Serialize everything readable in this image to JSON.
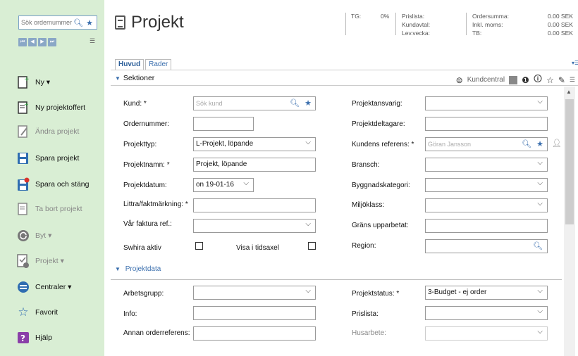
{
  "sidebar": {
    "search_placeholder": "Sök ordernummer",
    "nav": [
      "⏮",
      "◀",
      "▶",
      "⏭"
    ],
    "items": [
      {
        "label": "Ny ▾",
        "icon": "new-document-icon"
      },
      {
        "label": "Ny projektoffert",
        "icon": "quote-document-icon"
      },
      {
        "label": "Ändra projekt",
        "icon": "edit-document-icon"
      },
      {
        "label": "Spara projekt",
        "icon": "save-icon"
      },
      {
        "label": "Spara och stäng",
        "icon": "save-close-icon"
      },
      {
        "label": "Ta bort projekt",
        "icon": "delete-document-icon"
      },
      {
        "label": "Byt ▾",
        "icon": "switch-icon"
      },
      {
        "label": "Projekt ▾",
        "icon": "project-icon"
      },
      {
        "label": "Centraler ▾",
        "icon": "central-icon"
      },
      {
        "label": "Favorit",
        "icon": "star-icon"
      },
      {
        "label": "Hjälp",
        "icon": "help-icon"
      }
    ]
  },
  "header": {
    "title": "Projekt",
    "tg_label": "TG:",
    "tg_value": "0%",
    "prislista_label": "Prislista:",
    "kundavtal_label": "Kundavtal:",
    "levvecka_label": "Lev.vecka:",
    "ordersumma_label": "Ordersumma:",
    "inklmoms_label": "Inkl. moms:",
    "tb_label": "TB:",
    "ordersumma_value": "0.00 SEK",
    "inklmoms_value": "0.00 SEK",
    "tb_value": "0.00 SEK"
  },
  "tabs": [
    "Huvud",
    "Rader"
  ],
  "toolbar": {
    "section_label": "Sektioner",
    "kundcentral_label": "Kundcentral"
  },
  "form": {
    "kund_label": "Kund: *",
    "kund_placeholder": "Sök kund",
    "ordernummer_label": "Ordernummer:",
    "projekttyp_label": "Projekttyp:",
    "projekttyp_value": "L-Projekt, löpande",
    "projektnamn_label": "Projektnamn: *",
    "projektnamn_value": "Projekt, löpande",
    "projektdatum_label": "Projektdatum:",
    "projektdatum_value": "on 19-01-16",
    "littra_label": "Littra/faktmärkning: *",
    "varfaktura_label": "Vår faktura ref.:",
    "swhira_label": "Swhira aktiv",
    "visa_label": "Visa i tidsaxel",
    "projektansvarig_label": "Projektansvarig:",
    "projektdeltagare_label": "Projektdeltagare:",
    "kundensref_label": "Kundens referens: *",
    "kundensref_placeholder": "Göran Jansson",
    "bransch_label": "Bransch:",
    "byggnadskategori_label": "Byggnadskategori:",
    "miljoklass_label": "Miljöklass:",
    "grans_label": "Gräns upparbetat:",
    "region_label": "Region:",
    "section2_label": "Projektdata",
    "arbetsgrupp_label": "Arbetsgrupp:",
    "info_label": "Info:",
    "annan_label": "Annan orderreferens:",
    "projektstatus_label": "Projektstatus: *",
    "projektstatus_value": "3-Budget - ej order",
    "prislista_label": "Prislista:",
    "husarbete_label": "Husarbete:"
  }
}
